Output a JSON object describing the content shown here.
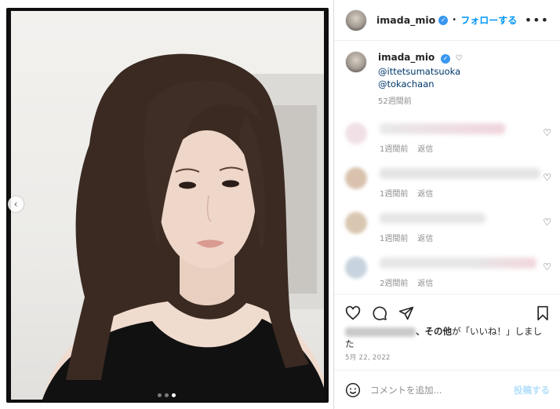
{
  "header": {
    "username": "imada_mio",
    "separator": "•",
    "follow_label": "フォローする",
    "more_label": "•••"
  },
  "caption": {
    "username": "imada_mio",
    "mentions": [
      "@ittetsumatsuoka",
      "@tokachaan"
    ],
    "time": "52週間前"
  },
  "comments": [
    {
      "time": "1週間前",
      "reply": "返信",
      "avatar_color": "#f1e1e6",
      "text_color": "#f0d4dc",
      "text_width": 160
    },
    {
      "time": "1週間前",
      "reply": "返信",
      "avatar_color": "#d8c2ad",
      "text_color": "#e4e4e4",
      "text_width": 205
    },
    {
      "time": "1週間前",
      "reply": "返信",
      "avatar_color": "#d9c6b0",
      "text_color": "#e6e6e6",
      "text_width": 135
    },
    {
      "time": "2週間前",
      "reply": "返信",
      "avatar_color": "#c7d3de",
      "text_color": "#eadadd",
      "text_width": 200
    }
  ],
  "likes": {
    "other_label": "、その他",
    "suffix": "が「いいね！」しました"
  },
  "post_date": "5月 22, 2022",
  "add_comment": {
    "placeholder": "コメントを追加...",
    "post_label": "投稿する"
  },
  "carousel": {
    "index": 3,
    "total": 3
  },
  "colors": {
    "accent": "#0095f6",
    "link": "#00376b",
    "muted": "#8e8e8e"
  },
  "icons": [
    "chevron-left-icon",
    "verified-badge-icon",
    "more-icon",
    "heart-icon",
    "comment-icon",
    "share-icon",
    "bookmark-icon",
    "emoji-icon"
  ]
}
